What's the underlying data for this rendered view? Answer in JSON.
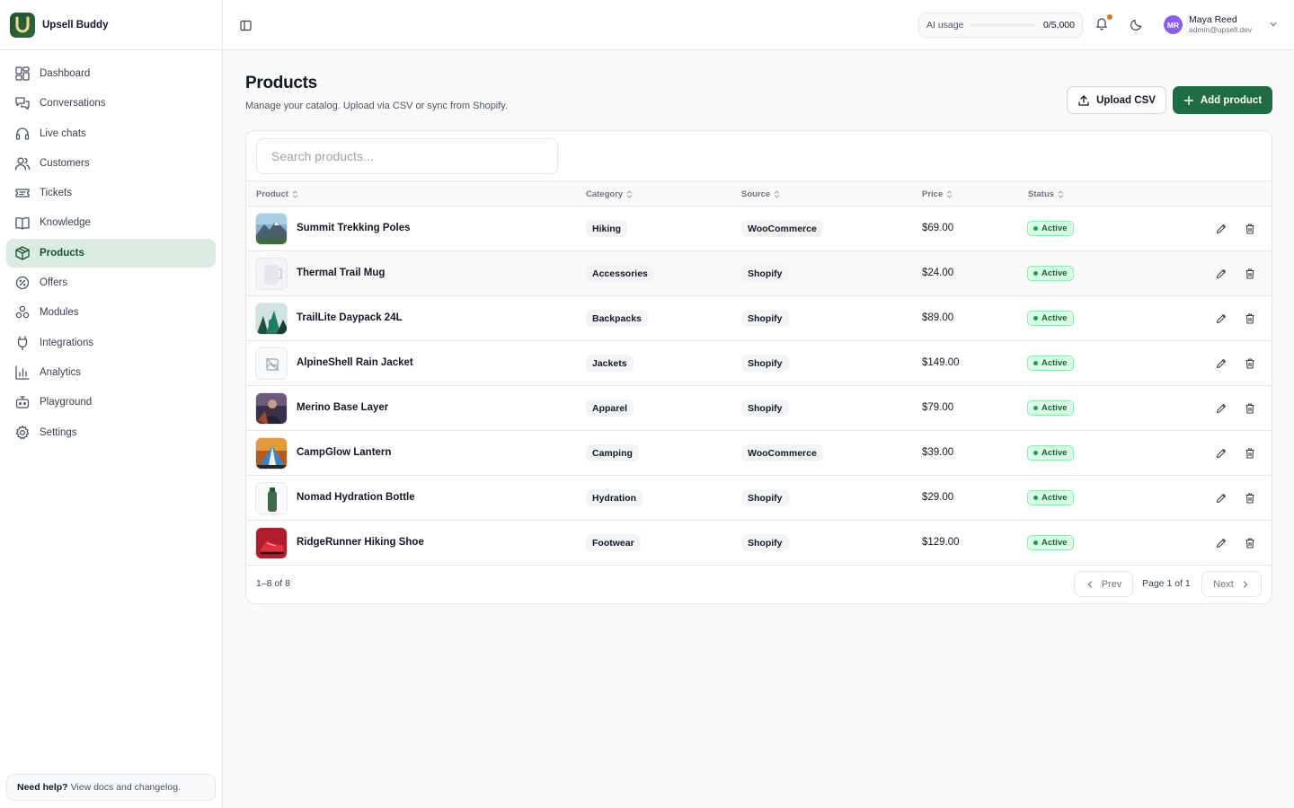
{
  "brand": {
    "name": "Upsell Buddy",
    "logo_letter": "U"
  },
  "sidebar": {
    "items": [
      {
        "label": "Dashboard",
        "icon": "dashboard-icon"
      },
      {
        "label": "Conversations",
        "icon": "conversations-icon"
      },
      {
        "label": "Live chats",
        "icon": "headset-icon"
      },
      {
        "label": "Customers",
        "icon": "users-icon"
      },
      {
        "label": "Tickets",
        "icon": "ticket-icon"
      },
      {
        "label": "Knowledge",
        "icon": "book-icon"
      },
      {
        "label": "Products",
        "icon": "box-icon",
        "active": true
      },
      {
        "label": "Offers",
        "icon": "offer-badge-icon"
      },
      {
        "label": "Modules",
        "icon": "modules-icon"
      },
      {
        "label": "Integrations",
        "icon": "plug-icon"
      },
      {
        "label": "Analytics",
        "icon": "chart-icon"
      },
      {
        "label": "Playground",
        "icon": "bot-icon"
      },
      {
        "label": "Settings",
        "icon": "gear-icon"
      }
    ],
    "help": {
      "title": "Need help?",
      "text": "View docs and changelog."
    }
  },
  "header": {
    "ai_usage": {
      "label": "AI usage",
      "count": "0/5,000",
      "fraction": 0
    },
    "user": {
      "initials": "MR",
      "name": "Maya Reed",
      "email": "admin@upsell.dev"
    }
  },
  "page": {
    "title": "Products",
    "subtitle": "Manage your catalog. Upload via CSV or sync from Shopify.",
    "upload_label": "Upload CSV",
    "add_label": "Add product"
  },
  "table": {
    "search_placeholder": "Search products...",
    "columns": {
      "product": "Product",
      "category": "Category",
      "source": "Source",
      "price": "Price",
      "status": "Status"
    },
    "rows": [
      {
        "name": "Summit Trekking Poles",
        "category": "Hiking",
        "source": "WooCommerce",
        "price": "$69.00",
        "status": "Active",
        "thumb": "mountain"
      },
      {
        "name": "Thermal Trail Mug",
        "category": "Accessories",
        "source": "Shopify",
        "price": "$24.00",
        "status": "Active",
        "thumb": "mug"
      },
      {
        "name": "TrailLite Daypack 24L",
        "category": "Backpacks",
        "source": "Shopify",
        "price": "$89.00",
        "status": "Active",
        "thumb": "forest"
      },
      {
        "name": "AlpineShell Rain Jacket",
        "category": "Jackets",
        "source": "Shopify",
        "price": "$149.00",
        "status": "Active",
        "thumb": "none"
      },
      {
        "name": "Merino Base Layer",
        "category": "Apparel",
        "source": "Shopify",
        "price": "$79.00",
        "status": "Active",
        "thumb": "person"
      },
      {
        "name": "CampGlow Lantern",
        "category": "Camping",
        "source": "WooCommerce",
        "price": "$39.00",
        "status": "Active",
        "thumb": "tent"
      },
      {
        "name": "Nomad Hydration Bottle",
        "category": "Hydration",
        "source": "Shopify",
        "price": "$29.00",
        "status": "Active",
        "thumb": "bottle"
      },
      {
        "name": "RidgeRunner Hiking Shoe",
        "category": "Footwear",
        "source": "Shopify",
        "price": "$129.00",
        "status": "Active",
        "thumb": "shoe"
      }
    ],
    "footer": {
      "count": "1–8 of 8",
      "prev": "Prev",
      "page_info": "Page 1 of 1",
      "next": "Next"
    }
  },
  "colors": {
    "accent": "#1f6b42",
    "active_nav_bg": "#dbede2",
    "status_green": "#16a34a"
  }
}
